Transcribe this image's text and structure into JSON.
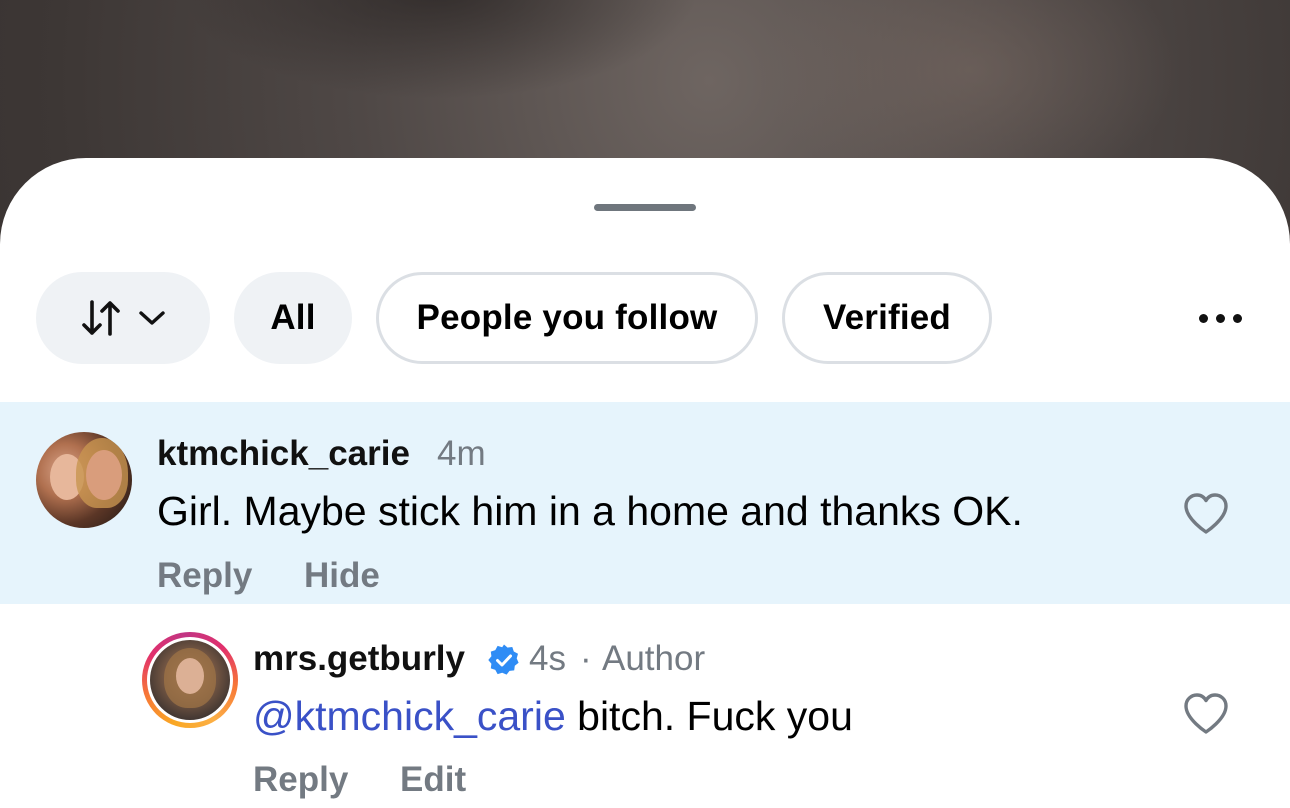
{
  "filters": {
    "sort_icon": "sort-arrows-icon",
    "chips": [
      {
        "label": "All"
      },
      {
        "label": "People you follow"
      },
      {
        "label": "Verified"
      }
    ],
    "more_icon": "more-horizontal-icon"
  },
  "comments": [
    {
      "username": "ktmchick_carie",
      "time": "4m",
      "text": "Girl. Maybe stick him in a home and thanks OK.",
      "actions": {
        "reply": "Reply",
        "hide": "Hide"
      },
      "highlighted": true
    }
  ],
  "reply": {
    "username": "mrs.getburly",
    "verified": true,
    "time": "4s",
    "separator": "·",
    "role": "Author",
    "mention": "@ktmchick_carie",
    "text": " bitch. Fuck you",
    "actions": {
      "reply": "Reply",
      "edit": "Edit"
    }
  },
  "colors": {
    "highlight": "#e6f4fc",
    "mention": "#3a51c7",
    "verified": "#2f8cf5",
    "muted": "#737a82"
  }
}
